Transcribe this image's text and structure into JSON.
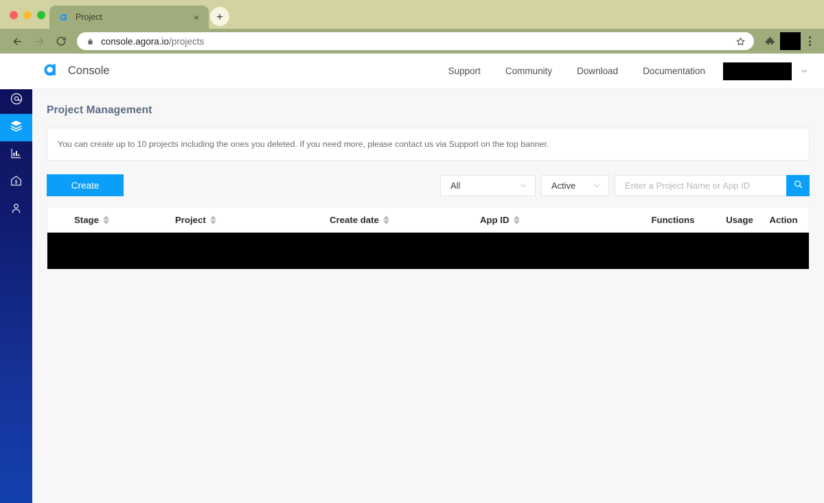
{
  "browser": {
    "tab": {
      "title": "Project",
      "favicon": "agora-a-icon",
      "close": "×"
    },
    "newtab_label": "+",
    "nav": {
      "back": "back-arrow-icon",
      "forward": "forward-arrow-icon",
      "reload": "reload-icon"
    },
    "omnibox": {
      "lock": "lock-icon",
      "domain": "console.agora.io",
      "path": "/projects",
      "star": "star-icon"
    },
    "extensions_icon": "puzzle-piece-icon",
    "profile": "",
    "menu": "three-dot-menu-icon"
  },
  "app_header": {
    "logo": "agora-logo-icon",
    "brand": "Console",
    "links": [
      {
        "label": "Support"
      },
      {
        "label": "Community"
      },
      {
        "label": "Download"
      },
      {
        "label": "Documentation"
      }
    ],
    "account": "",
    "account_caret": "chevron-down-icon"
  },
  "sidebar": {
    "items": [
      {
        "name": "documents",
        "icon": "documents-stack-icon",
        "active": false
      },
      {
        "name": "at-circle",
        "icon": "at-circle-icon",
        "active": false
      },
      {
        "name": "projects",
        "icon": "layers-icon",
        "active": true
      },
      {
        "name": "analytics",
        "icon": "bar-chart-icon",
        "active": false
      },
      {
        "name": "billing",
        "icon": "house-dollar-icon",
        "active": false
      },
      {
        "name": "account",
        "icon": "person-icon",
        "active": false
      }
    ]
  },
  "main": {
    "page_title": "Project Management",
    "notice": "You can create up to 10 projects including the ones you deleted. If you need more, please contact us via Support on the top banner.",
    "create_button": "Create",
    "filter_type": {
      "value": "All",
      "caret": "chevron-down-icon"
    },
    "filter_status": {
      "value": "Active",
      "caret": "chevron-down-icon"
    },
    "search": {
      "value": "",
      "placeholder": "Enter a Project Name or App ID",
      "button_icon": "search-icon"
    },
    "table": {
      "columns": [
        {
          "label": "Stage",
          "sortable": true
        },
        {
          "label": "Project",
          "sortable": true
        },
        {
          "label": "Create date",
          "sortable": true
        },
        {
          "label": "App ID",
          "sortable": true
        },
        {
          "label": "Functions",
          "sortable": false
        },
        {
          "label": "Usage",
          "sortable": false
        },
        {
          "label": "Action",
          "sortable": false
        }
      ],
      "rows": [
        {
          "redacted": true
        }
      ]
    }
  },
  "colors": {
    "accent_blue": "#0c9ffa",
    "sidebar_top": "#0e1056",
    "sidebar_bottom": "#1440ad",
    "browser_chrome": "#9fad7c",
    "title_slate": "#5b6b84"
  }
}
